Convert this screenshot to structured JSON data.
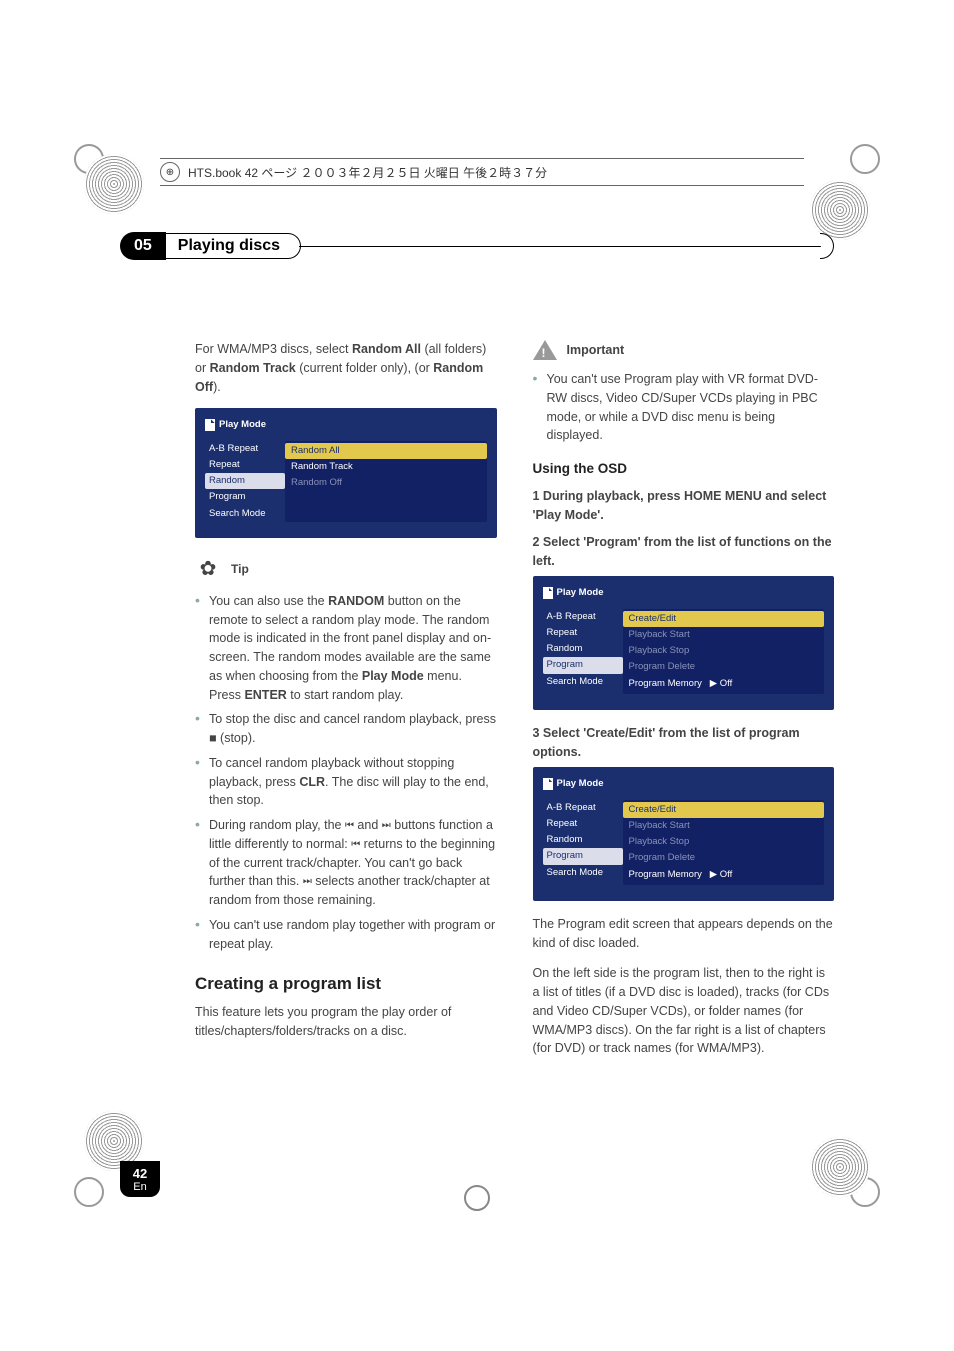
{
  "top_header": "HTS.book 42 ページ ２００３年２月２５日 火曜日 午後２時３７分",
  "section": {
    "num": "05",
    "title": "Playing discs"
  },
  "left": {
    "intro_a": "For WMA/MP3 discs, select ",
    "intro_b": " (all folders) or ",
    "intro_c": " (current folder only), (or ",
    "intro_d": ").",
    "random_all": "Random All",
    "random_track": "Random Track",
    "random_off": "Random Off",
    "menu1": {
      "title": "Play Mode",
      "left": [
        "A-B Repeat",
        "Repeat",
        "Random",
        "Program",
        "Search Mode"
      ],
      "right": [
        "Random All",
        "Random Track",
        "Random Off"
      ]
    },
    "tip_label": "Tip",
    "tips": [
      {
        "a": "You can also use the ",
        "key": "RANDOM",
        "b": " button on the remote to select a random play mode. The random mode is indicated in the front panel display and on-screen. The random modes available are the same as when choosing from the ",
        "key2": "Play Mode",
        "c": " menu. Press ",
        "key3": "ENTER",
        "d": " to start random play."
      },
      {
        "a": "To stop the disc and cancel random playback, press ",
        "icon": "■",
        "b": " (stop)."
      },
      {
        "a": "To cancel random playback without stopping playback, press ",
        "key": "CLR",
        "b": ". The disc will play to the end, then stop."
      },
      {
        "a": "During random play, the ",
        "i1": "⏮",
        "a2": " and ",
        "i2": "⏭",
        "b": " buttons function a little differently to normal: ",
        "i3": "⏮",
        "c": " returns to the beginning of the current track/chapter. You can't go back further than this. ",
        "i4": "⏭",
        "d": " selects another track/chapter at random from those remaining."
      },
      {
        "a": "You can't use random play together with program or repeat play."
      }
    ],
    "h2": "Creating a program list",
    "h2_body": "This feature lets you program the play order of titles/chapters/folders/tracks on a disc."
  },
  "right": {
    "important": "Important",
    "imp_item": "You can't use Program play with VR format DVD-RW discs, Video CD/Super VCDs playing in PBC mode, or while a DVD disc menu is being displayed.",
    "h3": "Using the OSD",
    "step1": "1 During playback, press HOME MENU and select 'Play Mode'.",
    "step2": "2 Select 'Program' from the list of functions on the left.",
    "menu2": {
      "title": "Play Mode",
      "left": [
        "A-B Repeat",
        "Repeat",
        "Random",
        "Program",
        "Search Mode"
      ],
      "right": [
        "Create/Edit",
        "Playback Start",
        "Playback Stop",
        "Program Delete",
        "Program Memory"
      ],
      "off": "Off"
    },
    "step3": "3 Select 'Create/Edit' from the list of program options.",
    "menu3": {
      "title": "Play Mode",
      "left": [
        "A-B Repeat",
        "Repeat",
        "Random",
        "Program",
        "Search Mode"
      ],
      "right": [
        "Create/Edit",
        "Playback Start",
        "Playback Stop",
        "Program Delete",
        "Program Memory"
      ],
      "off": "Off"
    },
    "body1": "The Program edit screen that appears depends on the kind of disc loaded.",
    "body2": "On the left side is the program list, then to the right is a list of titles (if a DVD disc is loaded), tracks (for CDs and Video CD/Super VCDs), or folder names (for WMA/MP3 discs). On the far right is a list of chapters (for DVD) or track names (for WMA/MP3)."
  },
  "footer": {
    "page": "42",
    "lang": "En"
  }
}
